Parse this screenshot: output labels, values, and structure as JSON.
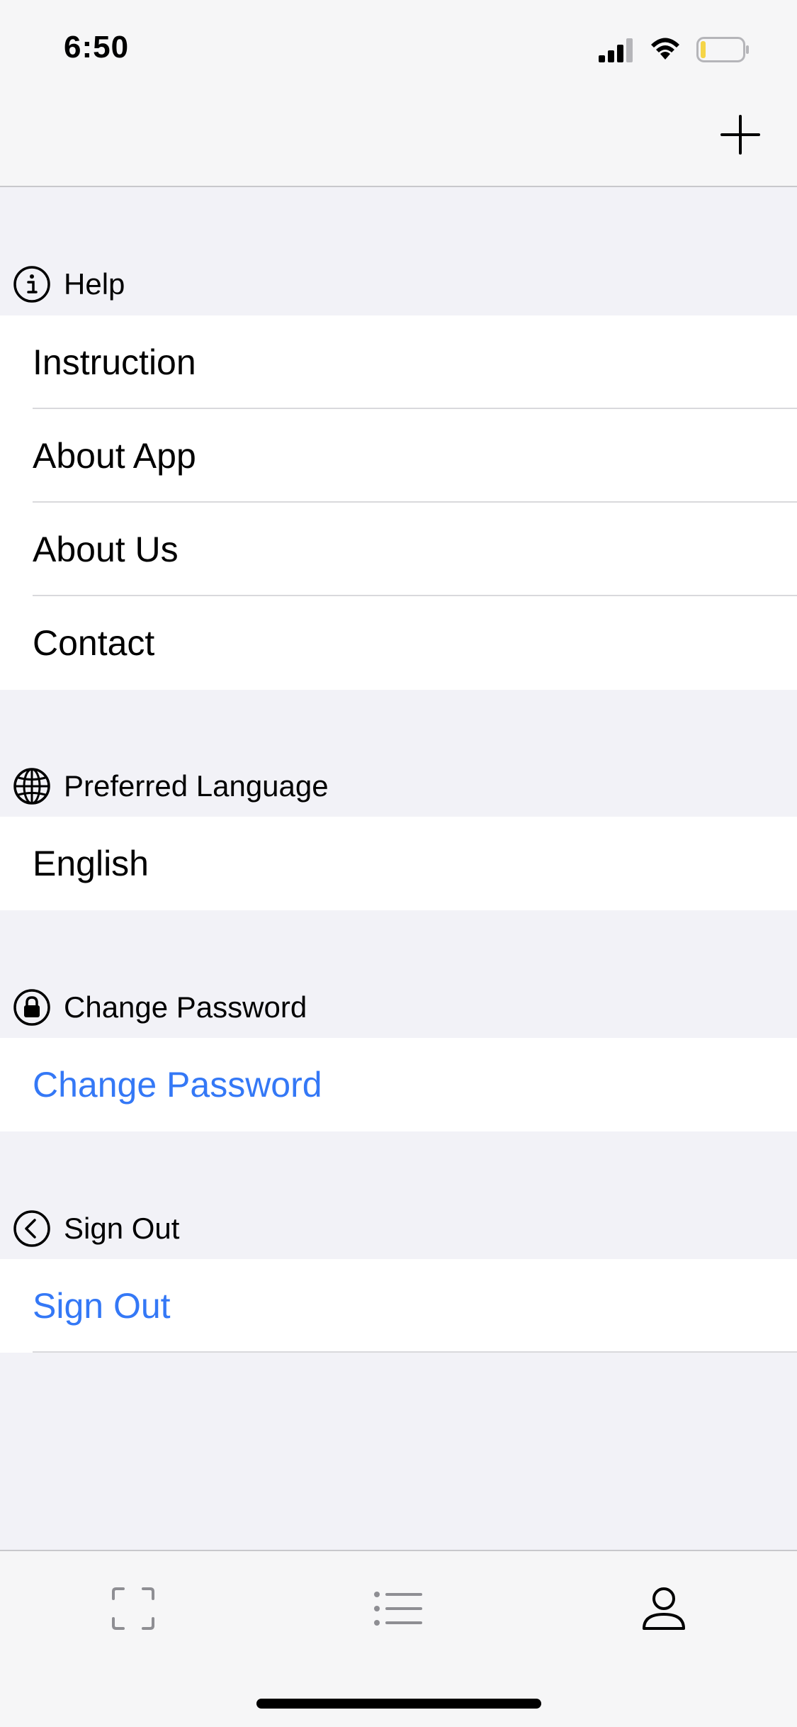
{
  "status_bar": {
    "time": "6:50"
  },
  "nav": {
    "add_icon": "plus-icon"
  },
  "sections": {
    "help": {
      "title": "Help",
      "icon": "info-circle-icon",
      "items": [
        "Instruction",
        "About App",
        "About Us",
        "Contact"
      ]
    },
    "language": {
      "title": "Preferred Language",
      "icon": "globe-icon",
      "value": "English"
    },
    "password": {
      "title": "Change Password",
      "icon": "lock-circle-icon",
      "action": "Change Password"
    },
    "signout": {
      "title": "Sign Out",
      "icon": "chevron-left-circle-icon",
      "action": "Sign Out"
    }
  },
  "tabbar": {
    "tabs": [
      {
        "icon": "scan-frame-icon",
        "selected": false
      },
      {
        "icon": "list-icon",
        "selected": false
      },
      {
        "icon": "person-icon",
        "selected": true
      }
    ]
  },
  "colors": {
    "link": "#3478f6",
    "background": "#f2f2f7",
    "bar": "#f6f6f7",
    "tab_inactive": "#8e8e93"
  }
}
